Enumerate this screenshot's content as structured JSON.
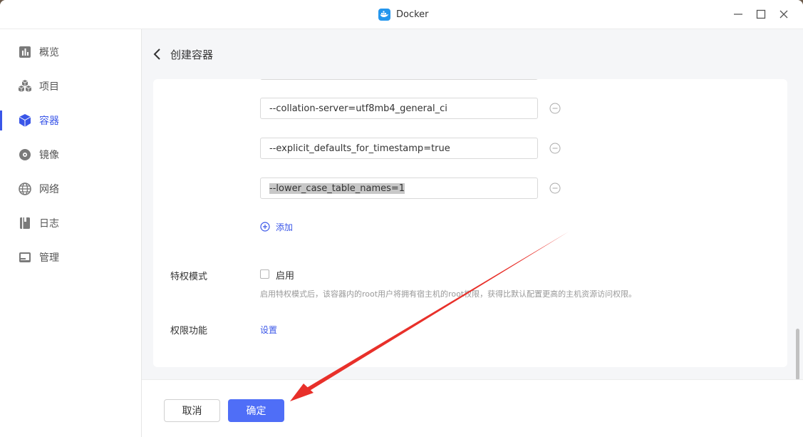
{
  "window": {
    "title": "Docker",
    "controls": [
      "minimize-icon",
      "maximize-icon",
      "close-icon"
    ]
  },
  "sidebar": {
    "items": [
      {
        "label": "概览",
        "icon": "chart-icon",
        "active": false
      },
      {
        "label": "项目",
        "icon": "cubes-icon",
        "active": false
      },
      {
        "label": "容器",
        "icon": "box-icon",
        "active": true
      },
      {
        "label": "镜像",
        "icon": "disc-icon",
        "active": false
      },
      {
        "label": "网络",
        "icon": "globe-icon",
        "active": false
      },
      {
        "label": "日志",
        "icon": "book-icon",
        "active": false
      },
      {
        "label": "管理",
        "icon": "window-icon",
        "active": false
      }
    ]
  },
  "main": {
    "title": "创建容器",
    "command_args": [
      {
        "value": "--collation-server=utf8mb4_general_ci",
        "selected": false
      },
      {
        "value": "--explicit_defaults_for_timestamp=true",
        "selected": false
      },
      {
        "value": "--lower_case_table_names=1",
        "selected": true
      }
    ],
    "add_label": "添加",
    "privileged": {
      "label": "特权模式",
      "checkbox_label": "启用",
      "checked": false,
      "hint": "启用特权模式后，该容器内的root用户将拥有宿主机的root权限，获得比默认配置更高的主机资源访问权限。"
    },
    "capabilities": {
      "label": "权限功能",
      "link": "设置"
    }
  },
  "footer": {
    "cancel_label": "取消",
    "confirm_label": "确定"
  },
  "colors": {
    "accent": "#3a56e8",
    "primary_button": "#4f6ef7",
    "annotation_arrow": "#e8302a"
  }
}
